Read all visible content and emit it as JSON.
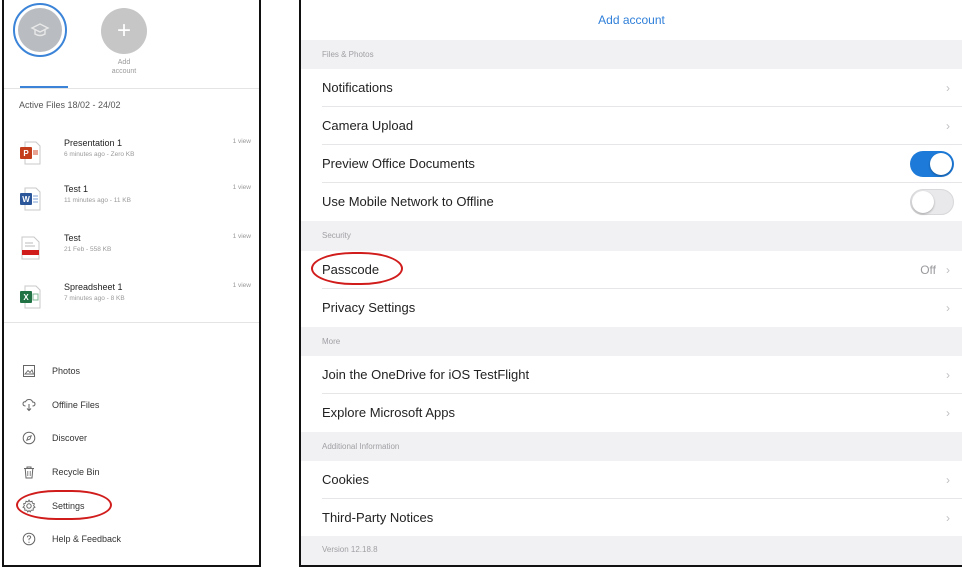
{
  "left": {
    "add_account_label_1": "Add",
    "add_account_label_2": "account",
    "active_files_label": "Active Files 18/02 - 24/02",
    "files": [
      {
        "name": "Presentation 1",
        "meta": "6 minutes ago - Zero KB",
        "views": "1 view",
        "icon": "powerpoint-icon",
        "color": "#c43e1c"
      },
      {
        "name": "Test 1",
        "meta": "11 minutes ago - 11 KB",
        "views": "1 view",
        "icon": "word-icon",
        "color": "#2b579a"
      },
      {
        "name": "Test",
        "meta": "21 Feb - 558 KB",
        "views": "1 view",
        "icon": "pdf-icon",
        "color": "#d11c1c"
      },
      {
        "name": "Spreadsheet 1",
        "meta": "7 minutes ago - 8 KB",
        "views": "1 view",
        "icon": "excel-icon",
        "color": "#217346"
      }
    ],
    "nav": [
      {
        "label": "Photos",
        "icon": "photo-icon"
      },
      {
        "label": "Offline Files",
        "icon": "offline-files-icon"
      },
      {
        "label": "Discover",
        "icon": "discover-icon"
      },
      {
        "label": "Recycle Bin",
        "icon": "recycle-bin-icon"
      },
      {
        "label": "Settings",
        "icon": "gear-icon"
      },
      {
        "label": "Help & Feedback",
        "icon": "help-icon"
      }
    ]
  },
  "right": {
    "add_account_link": "Add account",
    "sections": {
      "files_photos": "Files & Photos",
      "security": "Security",
      "more": "More",
      "additional_info": "Additional Information"
    },
    "rows": {
      "notifications": "Notifications",
      "camera_upload": "Camera Upload",
      "preview_office": "Preview Office Documents",
      "mobile_network": "Use Mobile Network to Offline",
      "passcode": "Passcode",
      "passcode_value": "Off",
      "privacy": "Privacy Settings",
      "testflight": "Join the OneDrive for iOS TestFlight",
      "explore": "Explore Microsoft Apps",
      "cookies": "Cookies",
      "third_party": "Third-Party Notices"
    },
    "toggles": {
      "preview_office": true,
      "mobile_network": false
    },
    "version": "Version 12.18.8"
  },
  "colors": {
    "accent": "#1d7ad8",
    "annotation": "#d11c1c"
  }
}
